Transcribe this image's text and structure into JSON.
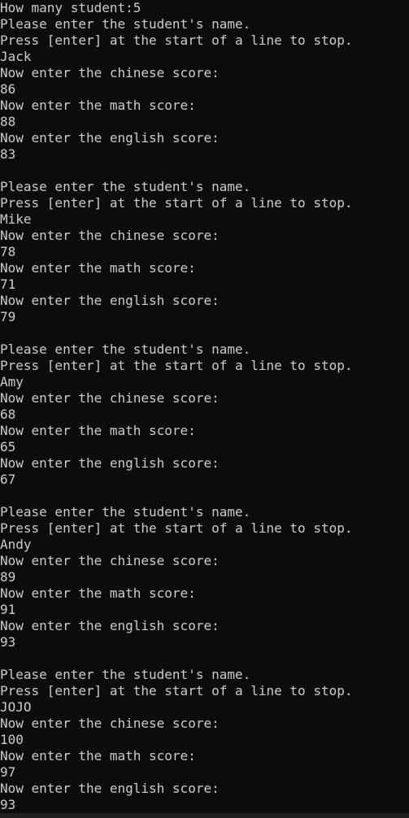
{
  "colors": {
    "background": "#0c0c0c",
    "text": "#cccccc"
  },
  "console": {
    "header": {
      "prompt": "How many student:",
      "count": "5"
    },
    "blocks": [
      {
        "prompt1": "Please enter the student's name.",
        "prompt2": "Press [enter] at the start of a line to stop.",
        "name": "Jack",
        "chinese_prompt": "Now enter the chinese score:",
        "chinese": "86",
        "math_prompt": "Now enter the math score:",
        "math": "88",
        "english_prompt": "Now enter the english score:",
        "english": "83"
      },
      {
        "prompt1": "Please enter the student's name.",
        "prompt2": "Press [enter] at the start of a line to stop.",
        "name": "Mike",
        "chinese_prompt": "Now enter the chinese score:",
        "chinese": "78",
        "math_prompt": "Now enter the math score:",
        "math": "71",
        "english_prompt": "Now enter the english score:",
        "english": "79"
      },
      {
        "prompt1": "Please enter the student's name.",
        "prompt2": "Press [enter] at the start of a line to stop.",
        "name": "Amy",
        "chinese_prompt": "Now enter the chinese score:",
        "chinese": "68",
        "math_prompt": "Now enter the math score:",
        "math": "65",
        "english_prompt": "Now enter the english score:",
        "english": "67"
      },
      {
        "prompt1": "Please enter the student's name.",
        "prompt2": "Press [enter] at the start of a line to stop.",
        "name": "Andy",
        "chinese_prompt": "Now enter the chinese score:",
        "chinese": "89",
        "math_prompt": "Now enter the math score:",
        "math": "91",
        "english_prompt": "Now enter the english score:",
        "english": "93"
      },
      {
        "prompt1": "Please enter the student's name.",
        "prompt2": "Press [enter] at the start of a line to stop.",
        "name": "JOJO",
        "chinese_prompt": "Now enter the chinese score:",
        "chinese": "100",
        "math_prompt": "Now enter the math score:",
        "math": "97",
        "english_prompt": "Now enter the english score:",
        "english": "93"
      }
    ]
  }
}
